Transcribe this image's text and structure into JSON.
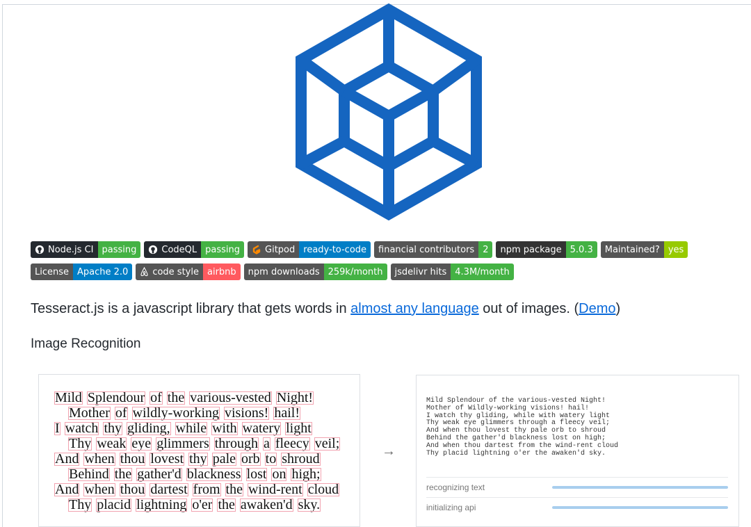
{
  "badges_row1": [
    {
      "label": "Node.js CI",
      "value": "passing",
      "icon": "github-icon",
      "value_color": "#4c1"
    },
    {
      "label": "CodeQL",
      "value": "passing",
      "icon": "github-icon",
      "value_color": "#4c1"
    },
    {
      "label": "Gitpod",
      "value": "ready-to-code",
      "icon": "gitpod-icon",
      "value_color": "#007ec6"
    },
    {
      "label": "financial contributors",
      "value": "2",
      "icon": "",
      "value_color": "#4c1"
    },
    {
      "label": "npm package",
      "value": "5.0.3",
      "icon": "",
      "value_color": "#4c1"
    },
    {
      "label": "Maintained?",
      "value": "yes",
      "icon": "",
      "value_color": "#97ca00"
    }
  ],
  "badges_row2": [
    {
      "label": "License",
      "value": "Apache 2.0",
      "icon": "",
      "value_color": "#007ec6"
    },
    {
      "label": "code style",
      "value": "airbnb",
      "icon": "airbnb-icon",
      "value_color": "#ff5a5f"
    },
    {
      "label": "npm downloads",
      "value": "259k/month",
      "icon": "",
      "value_color": "#4c1"
    },
    {
      "label": "jsdelivr hits",
      "value": "4.3M/month",
      "icon": "",
      "value_color": "#4c1"
    }
  ],
  "intro": {
    "before": "Tesseract.js is a javascript library that gets words in ",
    "link1": "almost any language",
    "middle": " out of images. (",
    "link2": "Demo",
    "after": ")"
  },
  "section_heading": "Image Recognition",
  "poem_lines": [
    {
      "indent": 0,
      "words": [
        "Mild",
        "Splendour",
        "of",
        "the",
        "various-vested",
        "Night!"
      ]
    },
    {
      "indent": 20,
      "words": [
        "Mother",
        "of",
        "wildly-working",
        "visions!",
        "hail!"
      ]
    },
    {
      "indent": 0,
      "words": [
        "I",
        "watch",
        "thy",
        "gliding,",
        "while",
        "with",
        "watery",
        "light"
      ]
    },
    {
      "indent": 20,
      "words": [
        "Thy",
        "weak",
        "eye",
        "glimmers",
        "through",
        "a",
        "fleecy",
        "veil;"
      ]
    },
    {
      "indent": 0,
      "words": [
        "And",
        "when",
        "thou",
        "lovest",
        "thy",
        "pale",
        "orb",
        "to",
        "shroud"
      ]
    },
    {
      "indent": 20,
      "words": [
        "Behind",
        "the",
        "gather'd",
        "blackness",
        "lost",
        "on",
        "high;"
      ]
    },
    {
      "indent": 0,
      "words": [
        "And",
        "when",
        "thou",
        "dartest",
        "from",
        "the",
        "wind-rent",
        "cloud"
      ]
    },
    {
      "indent": 20,
      "words": [
        "Thy",
        "placid",
        "lightning",
        "o'er",
        "the",
        "awaken'd",
        "sky."
      ]
    }
  ],
  "arrow": "→",
  "ocr_output": [
    "Mild Splendour of the various-vested Night!",
    "Mother of Wildly-working visions! hail!",
    "I watch thy gliding, while with watery light",
    "Thy weak eye glimmers through a fleecy veil;",
    "And when thou lovest thy pale orb to shroud",
    "Behind the gather'd blackness lost on high;",
    "And when thou dartest from the wind-rent cloud",
    "Thy placid lightning o'er the awaken'd sky."
  ],
  "progress": [
    {
      "label": "recognizing text",
      "fraction": 1.0
    },
    {
      "label": "initializing api",
      "fraction": 1.0
    }
  ],
  "colors": {
    "logo_blue": "#1565c0",
    "link": "#0969da"
  }
}
